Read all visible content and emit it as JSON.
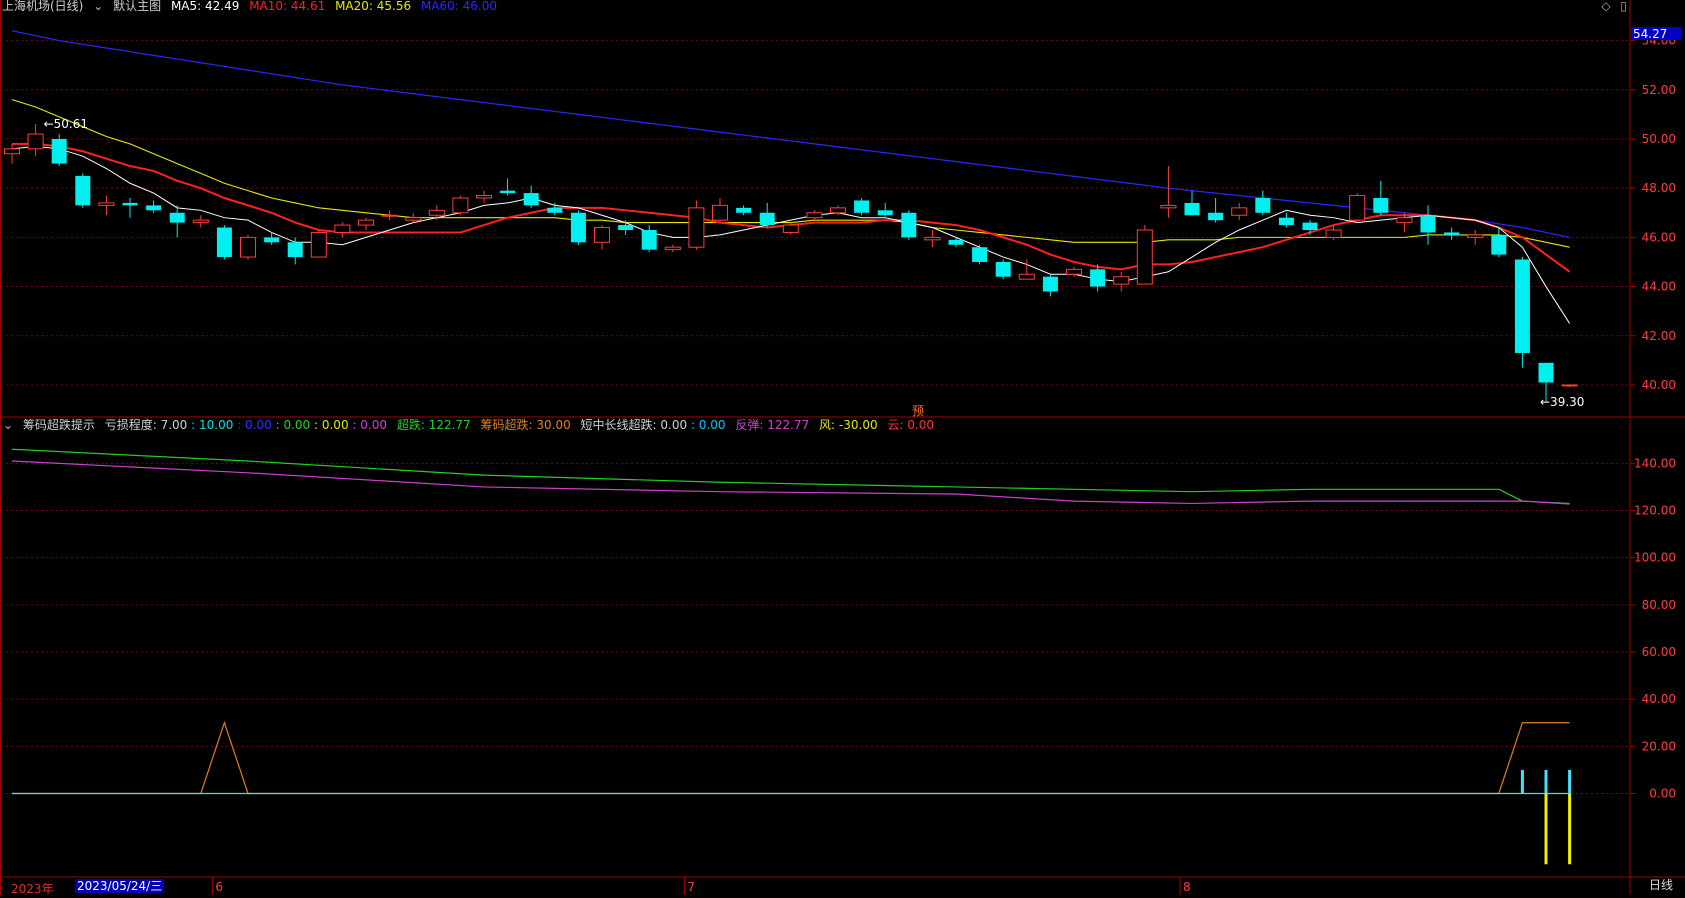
{
  "header": {
    "stock_name": "上海机场(日线)",
    "main_chart_name": "默认主图",
    "ma5": "MA5: 42.49",
    "ma10": "MA10: 44.61",
    "ma20": "MA20: 45.56",
    "ma60": "MA60: 46.00"
  },
  "indicator_header": {
    "name": "筹码超跌提示",
    "loss_degree": "亏损程度: 7.00",
    "v1": ": 10.00",
    "v2": ": 0.00",
    "v3": ": 0.00",
    "v4": ": 0.00",
    "v5": ": 0.00",
    "chaodie": "超跌: 122.77",
    "chouma_chaodie": "筹码超跌: 30.00",
    "short_long": "短中长线超跌: 0.00",
    "v6": ": 0.00",
    "fantan": "反弹: 122.77",
    "feng": "风: -30.00",
    "yun": "云: 0.00"
  },
  "colors": {
    "up": "#ff3c3c",
    "down": "#00f0f0",
    "ma5": "#ffffff",
    "ma10": "#ff2020",
    "ma20": "#e8e800",
    "ma60": "#2828ff",
    "grid": "#7a0000",
    "axis_text": "#ff3c3c",
    "green_line": "#20d020",
    "magenta_line": "#d040d0",
    "orange_line": "#e08020",
    "bar_yellow": "#f0f000",
    "bar_cyan": "#40e0ff"
  },
  "pre_mark": "预",
  "period_tag": "日线",
  "date_cursor": "2023/05/24/三",
  "year_label": "2023年",
  "chart_data": [
    {
      "type": "candlestick",
      "ylim": [
        38.9,
        55.0
      ],
      "ytick_labels": [
        "40.00",
        "42.00",
        "44.00",
        "46.00",
        "48.00",
        "50.00",
        "52.00",
        "54.00"
      ],
      "ytick_values": [
        40,
        42,
        44,
        46,
        48,
        50,
        52,
        54
      ],
      "current_price_label": "54.27",
      "current_price_value": 54.27,
      "high_marker": "50.61",
      "low_marker": "39.30",
      "x_month_labels": [
        {
          "label": "6",
          "index": 9
        },
        {
          "label": "7",
          "index": 29
        },
        {
          "label": "8",
          "index": 50
        }
      ],
      "candles": [
        {
          "o": 49.4,
          "h": 49.8,
          "l": 49.0,
          "c": 49.6
        },
        {
          "o": 49.6,
          "h": 50.61,
          "l": 49.3,
          "c": 50.2
        },
        {
          "o": 50.0,
          "h": 50.2,
          "l": 48.9,
          "c": 49.0
        },
        {
          "o": 48.5,
          "h": 48.6,
          "l": 47.2,
          "c": 47.3
        },
        {
          "o": 47.3,
          "h": 47.7,
          "l": 46.9,
          "c": 47.4
        },
        {
          "o": 47.4,
          "h": 47.6,
          "l": 46.8,
          "c": 47.3
        },
        {
          "o": 47.3,
          "h": 47.5,
          "l": 47.0,
          "c": 47.1
        },
        {
          "o": 47.0,
          "h": 47.3,
          "l": 46.0,
          "c": 46.6
        },
        {
          "o": 46.6,
          "h": 46.9,
          "l": 46.4,
          "c": 46.7
        },
        {
          "o": 46.4,
          "h": 46.5,
          "l": 45.1,
          "c": 45.2
        },
        {
          "o": 45.2,
          "h": 46.1,
          "l": 45.1,
          "c": 46.0
        },
        {
          "o": 46.0,
          "h": 46.2,
          "l": 45.7,
          "c": 45.8
        },
        {
          "o": 45.8,
          "h": 46.0,
          "l": 44.9,
          "c": 45.2
        },
        {
          "o": 45.2,
          "h": 46.3,
          "l": 45.2,
          "c": 46.2
        },
        {
          "o": 46.2,
          "h": 46.6,
          "l": 46.0,
          "c": 46.5
        },
        {
          "o": 46.5,
          "h": 46.8,
          "l": 46.3,
          "c": 46.7
        },
        {
          "o": 46.9,
          "h": 47.1,
          "l": 46.7,
          "c": 46.9
        },
        {
          "o": 46.7,
          "h": 47.0,
          "l": 46.6,
          "c": 46.8
        },
        {
          "o": 46.9,
          "h": 47.3,
          "l": 46.7,
          "c": 47.1
        },
        {
          "o": 47.0,
          "h": 47.7,
          "l": 46.9,
          "c": 47.6
        },
        {
          "o": 47.6,
          "h": 47.9,
          "l": 47.4,
          "c": 47.7
        },
        {
          "o": 47.9,
          "h": 48.4,
          "l": 47.7,
          "c": 47.8
        },
        {
          "o": 47.8,
          "h": 48.1,
          "l": 47.2,
          "c": 47.3
        },
        {
          "o": 47.2,
          "h": 47.4,
          "l": 46.9,
          "c": 47.0
        },
        {
          "o": 47.0,
          "h": 47.1,
          "l": 45.7,
          "c": 45.8
        },
        {
          "o": 45.8,
          "h": 46.5,
          "l": 45.5,
          "c": 46.4
        },
        {
          "o": 46.5,
          "h": 46.7,
          "l": 46.1,
          "c": 46.3
        },
        {
          "o": 46.3,
          "h": 46.5,
          "l": 45.4,
          "c": 45.5
        },
        {
          "o": 45.5,
          "h": 45.7,
          "l": 45.4,
          "c": 45.6
        },
        {
          "o": 45.6,
          "h": 47.5,
          "l": 45.5,
          "c": 47.2
        },
        {
          "o": 46.7,
          "h": 47.6,
          "l": 46.6,
          "c": 47.3
        },
        {
          "o": 47.2,
          "h": 47.3,
          "l": 46.9,
          "c": 47.0
        },
        {
          "o": 47.0,
          "h": 47.4,
          "l": 46.4,
          "c": 46.5
        },
        {
          "o": 46.2,
          "h": 46.6,
          "l": 46.1,
          "c": 46.5
        },
        {
          "o": 46.8,
          "h": 47.1,
          "l": 46.7,
          "c": 47.0
        },
        {
          "o": 47.0,
          "h": 47.3,
          "l": 46.9,
          "c": 47.2
        },
        {
          "o": 47.5,
          "h": 47.6,
          "l": 46.9,
          "c": 47.0
        },
        {
          "o": 47.1,
          "h": 47.4,
          "l": 46.8,
          "c": 46.9
        },
        {
          "o": 47.0,
          "h": 47.1,
          "l": 45.9,
          "c": 46.0
        },
        {
          "o": 45.9,
          "h": 46.3,
          "l": 45.6,
          "c": 46.0
        },
        {
          "o": 45.9,
          "h": 46.0,
          "l": 45.6,
          "c": 45.7
        },
        {
          "o": 45.6,
          "h": 45.7,
          "l": 44.9,
          "c": 45.0
        },
        {
          "o": 45.0,
          "h": 45.1,
          "l": 44.3,
          "c": 44.4
        },
        {
          "o": 44.3,
          "h": 45.1,
          "l": 44.3,
          "c": 44.5
        },
        {
          "o": 44.4,
          "h": 44.5,
          "l": 43.6,
          "c": 43.8
        },
        {
          "o": 44.5,
          "h": 44.8,
          "l": 44.4,
          "c": 44.7
        },
        {
          "o": 44.7,
          "h": 44.9,
          "l": 43.8,
          "c": 44.0
        },
        {
          "o": 44.1,
          "h": 44.6,
          "l": 43.8,
          "c": 44.4
        },
        {
          "o": 44.1,
          "h": 46.5,
          "l": 44.1,
          "c": 46.3
        },
        {
          "o": 47.2,
          "h": 48.9,
          "l": 46.8,
          "c": 47.3
        },
        {
          "o": 47.4,
          "h": 47.9,
          "l": 46.9,
          "c": 46.9
        },
        {
          "o": 47.0,
          "h": 47.6,
          "l": 46.6,
          "c": 46.7
        },
        {
          "o": 46.9,
          "h": 47.4,
          "l": 46.7,
          "c": 47.2
        },
        {
          "o": 47.6,
          "h": 47.9,
          "l": 46.9,
          "c": 47.0
        },
        {
          "o": 46.8,
          "h": 47.0,
          "l": 46.4,
          "c": 46.5
        },
        {
          "o": 46.6,
          "h": 46.7,
          "l": 46.1,
          "c": 46.3
        },
        {
          "o": 46.0,
          "h": 46.5,
          "l": 45.9,
          "c": 46.3
        },
        {
          "o": 46.7,
          "h": 47.8,
          "l": 46.6,
          "c": 47.7
        },
        {
          "o": 47.6,
          "h": 48.3,
          "l": 46.9,
          "c": 47.0
        },
        {
          "o": 46.6,
          "h": 47.0,
          "l": 46.2,
          "c": 46.8
        },
        {
          "o": 46.9,
          "h": 47.3,
          "l": 45.7,
          "c": 46.2
        },
        {
          "o": 46.2,
          "h": 46.4,
          "l": 45.9,
          "c": 46.1
        },
        {
          "o": 46.0,
          "h": 46.3,
          "l": 45.7,
          "c": 46.1
        },
        {
          "o": 46.1,
          "h": 46.4,
          "l": 45.2,
          "c": 45.3
        },
        {
          "o": 45.1,
          "h": 45.2,
          "l": 40.7,
          "c": 41.3
        },
        {
          "o": 40.9,
          "h": 40.9,
          "l": 39.3,
          "c": 40.1
        },
        {
          "o": 40.0,
          "h": 40.0,
          "l": 39.9,
          "c": 40.0
        }
      ],
      "ma5": [
        49.6,
        49.7,
        49.6,
        49.3,
        48.8,
        48.2,
        47.8,
        47.2,
        47.1,
        46.8,
        46.7,
        46.2,
        45.8,
        45.8,
        45.7,
        46.0,
        46.3,
        46.6,
        46.8,
        47.0,
        47.3,
        47.4,
        47.6,
        47.3,
        47.2,
        46.9,
        46.6,
        46.2,
        46.0,
        46.0,
        46.1,
        46.3,
        46.5,
        46.7,
        46.9,
        47.0,
        46.8,
        46.8,
        46.6,
        46.4,
        46.0,
        45.6,
        45.2,
        44.9,
        44.5,
        44.5,
        44.3,
        44.2,
        44.4,
        44.6,
        45.2,
        45.8,
        46.3,
        46.7,
        47.1,
        46.9,
        46.8,
        46.6,
        46.7,
        46.8,
        46.9,
        46.8,
        46.7,
        46.4,
        45.6,
        44.0,
        42.5
      ],
      "ma10": [
        49.8,
        49.8,
        49.7,
        49.5,
        49.2,
        48.9,
        48.7,
        48.3,
        48.0,
        47.6,
        47.3,
        47.0,
        46.6,
        46.3,
        46.2,
        46.2,
        46.2,
        46.2,
        46.2,
        46.2,
        46.5,
        46.8,
        47.0,
        47.2,
        47.2,
        47.2,
        47.1,
        47.0,
        46.9,
        46.8,
        46.6,
        46.5,
        46.4,
        46.5,
        46.6,
        46.6,
        46.6,
        46.7,
        46.7,
        46.6,
        46.5,
        46.3,
        46.0,
        45.7,
        45.3,
        45.0,
        44.8,
        44.7,
        44.9,
        44.9,
        45.0,
        45.2,
        45.4,
        45.6,
        45.9,
        46.2,
        46.5,
        46.7,
        46.9,
        46.9,
        46.9,
        46.8,
        46.7,
        46.4,
        46.0,
        45.3,
        44.6
      ],
      "ma20": [
        51.6,
        51.3,
        50.9,
        50.5,
        50.1,
        49.8,
        49.4,
        49.0,
        48.6,
        48.2,
        47.9,
        47.6,
        47.4,
        47.2,
        47.1,
        47.0,
        46.9,
        46.8,
        46.8,
        46.8,
        46.8,
        46.8,
        46.8,
        46.8,
        46.7,
        46.7,
        46.6,
        46.6,
        46.6,
        46.6,
        46.6,
        46.6,
        46.6,
        46.6,
        46.7,
        46.7,
        46.7,
        46.7,
        46.6,
        46.4,
        46.3,
        46.2,
        46.1,
        46.0,
        45.9,
        45.8,
        45.8,
        45.8,
        45.8,
        45.9,
        45.9,
        45.9,
        46.0,
        46.0,
        46.0,
        46.0,
        46.0,
        46.0,
        46.0,
        46.0,
        46.1,
        46.1,
        46.1,
        46.1,
        46.0,
        45.8,
        45.6
      ],
      "ma60": [
        54.4,
        54.2,
        54.0,
        53.85,
        53.7,
        53.55,
        53.4,
        53.25,
        53.1,
        52.95,
        52.8,
        52.65,
        52.5,
        52.35,
        52.2,
        52.08,
        51.96,
        51.84,
        51.72,
        51.6,
        51.48,
        51.36,
        51.24,
        51.12,
        51.0,
        50.88,
        50.76,
        50.64,
        50.52,
        50.4,
        50.28,
        50.16,
        50.04,
        49.92,
        49.8,
        49.68,
        49.56,
        49.44,
        49.32,
        49.2,
        49.08,
        48.96,
        48.84,
        48.72,
        48.6,
        48.48,
        48.36,
        48.24,
        48.12,
        48.0,
        47.9,
        47.8,
        47.7,
        47.6,
        47.5,
        47.4,
        47.3,
        47.2,
        47.1,
        47.0,
        46.9,
        46.8,
        46.7,
        46.55,
        46.4,
        46.2,
        46.0
      ]
    },
    {
      "type": "line",
      "ylim": [
        -35,
        155
      ],
      "ytick_labels": [
        "0.00",
        "20.00",
        "40.00",
        "60.00",
        "80.00",
        "100.00",
        "120.00",
        "140.00"
      ],
      "ytick_values": [
        0,
        20,
        40,
        60,
        80,
        100,
        120,
        140
      ],
      "series": [
        {
          "name": "超跌",
          "color_key": "green_line",
          "x": [
            0,
            10,
            20,
            30,
            40,
            45,
            50,
            55,
            60,
            63,
            64,
            66
          ],
          "values": [
            146,
            141,
            135,
            132,
            130,
            129,
            128,
            129,
            129,
            129,
            124,
            123
          ]
        },
        {
          "name": "反弹",
          "color_key": "magenta_line",
          "x": [
            0,
            10,
            20,
            30,
            40,
            45,
            50,
            55,
            60,
            63,
            64,
            66
          ],
          "values": [
            141,
            136,
            130,
            128,
            127,
            124,
            123,
            124,
            124,
            124,
            124,
            122.77
          ]
        },
        {
          "name": "筹码超跌",
          "color_key": "orange_line",
          "x": [
            0,
            8,
            9,
            10,
            63,
            64,
            65,
            66
          ],
          "values": [
            0,
            0,
            30,
            0,
            0,
            30,
            30,
            30
          ]
        },
        {
          "name": "短中长线超跌",
          "color_key": "bar_cyan",
          "x": [
            0,
            66
          ],
          "values": [
            0,
            0
          ]
        }
      ],
      "bars": [
        {
          "x": 64,
          "value": 10,
          "color_key": "bar_cyan"
        },
        {
          "x": 65,
          "value": -30,
          "color_key": "bar_yellow"
        },
        {
          "x": 65,
          "value": 10,
          "color_key": "bar_cyan"
        },
        {
          "x": 66,
          "value": -30,
          "color_key": "bar_yellow"
        },
        {
          "x": 66,
          "value": 10,
          "color_key": "bar_cyan"
        }
      ]
    }
  ]
}
